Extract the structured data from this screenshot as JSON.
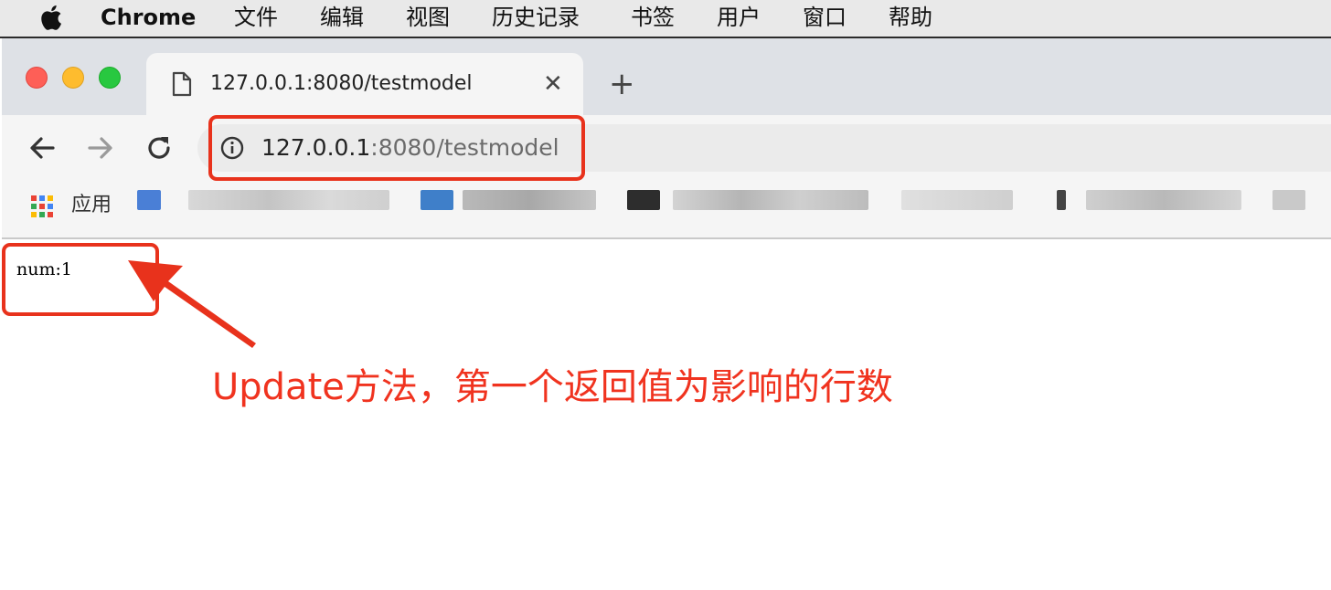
{
  "menubar": {
    "app_name": "Chrome",
    "items": [
      "文件",
      "编辑",
      "视图",
      "历史记录",
      "书签",
      "用户",
      "窗口",
      "帮助"
    ],
    "icons": [
      "apple-icon"
    ]
  },
  "tab": {
    "title": "127.0.0.1:8080/testmodel",
    "close_glyph": "✕",
    "new_tab_glyph": "+",
    "icon": "page-icon"
  },
  "toolbar": {
    "icons": [
      "back-icon",
      "forward-icon",
      "reload-icon",
      "info-icon"
    ],
    "url_host": "127.0.0.1",
    "url_rest": ":8080/testmodel"
  },
  "bookmarks": {
    "apps_label": "应用",
    "icon": "apps-grid-icon"
  },
  "page": {
    "num_text": "num:1"
  },
  "annotation": {
    "caption": "Update方法，第一个返回值为影响的行数",
    "color": "#e8321c"
  },
  "colors": {
    "close_red": "#fe5f57",
    "minimize_yellow": "#febc2e",
    "zoom_green": "#28c840",
    "annotation_red": "#e8321c"
  }
}
